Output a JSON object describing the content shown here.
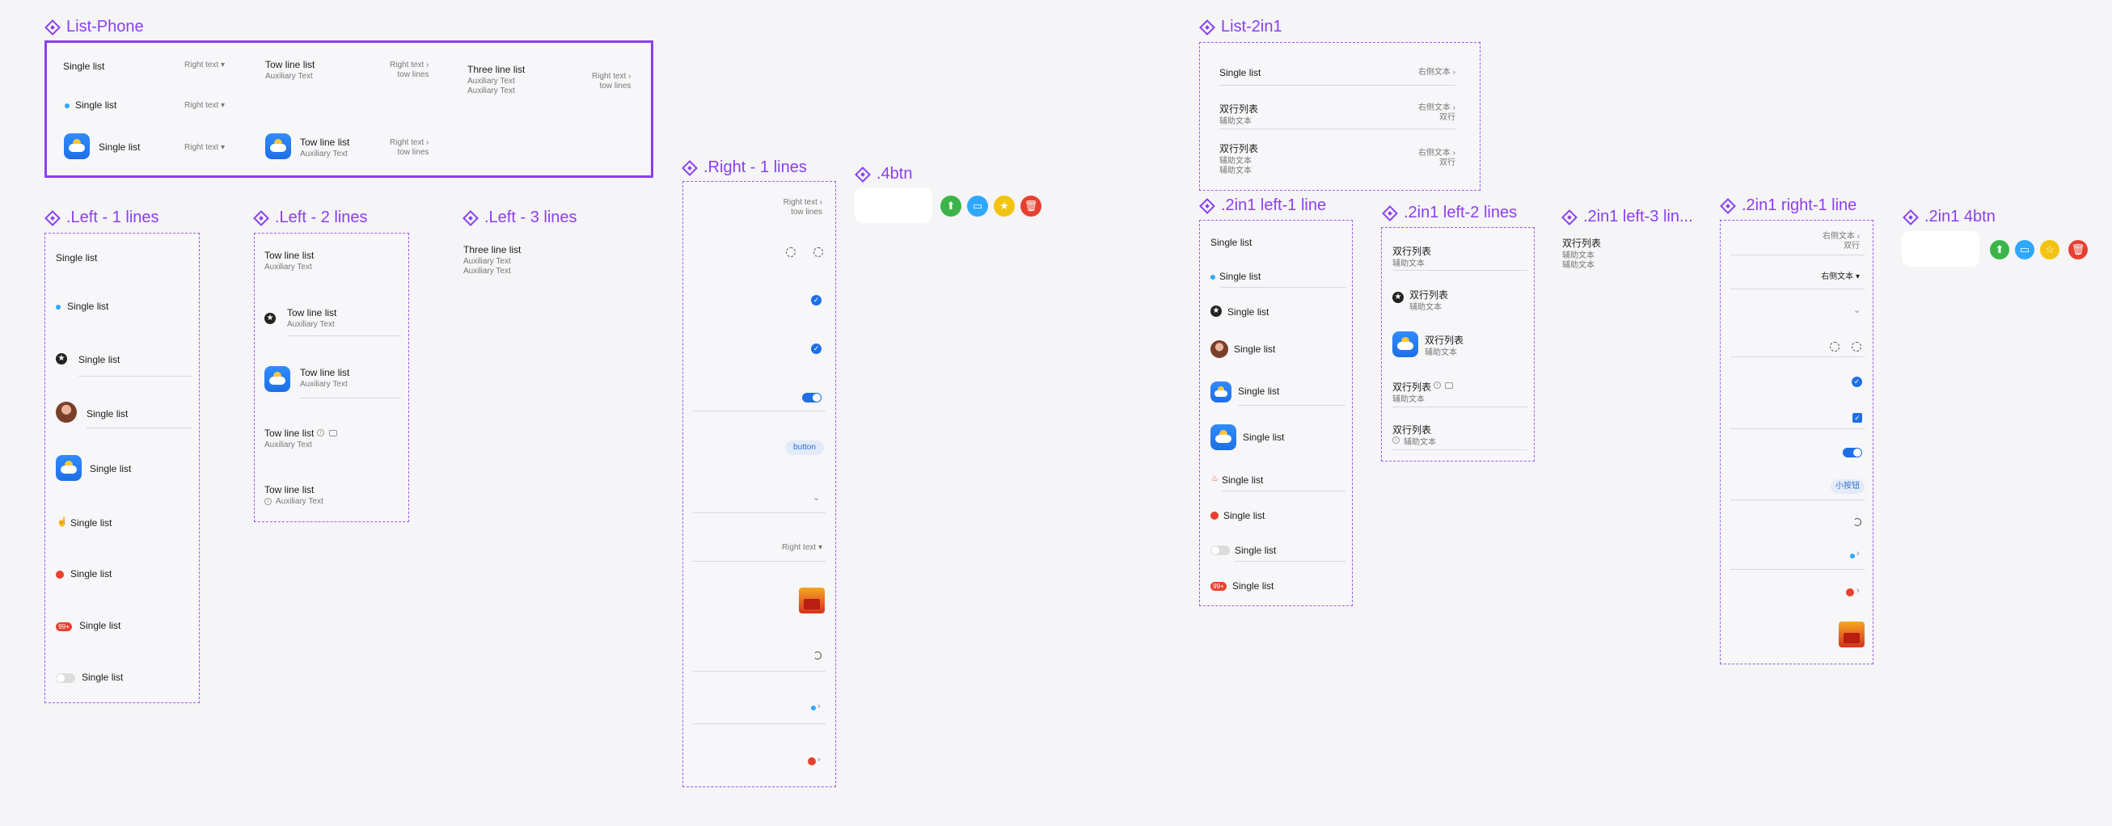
{
  "colors": {
    "accent": "#8a3ff0",
    "blue": "#1f6fe6",
    "green": "#3bb54a",
    "lightblue": "#2ea8ff",
    "yellow": "#f2c40f",
    "red": "#e8402f"
  },
  "frames": {
    "list_phone": "List-Phone",
    "left1": ".Left - 1 lines",
    "left2": ".Left - 2 lines",
    "left3": ".Left - 3 lines",
    "right1": ".Right - 1 lines",
    "fourbtn": ".4btn",
    "list_2in1": "List-2in1",
    "left1_2in1": ".2in1 left-1 line",
    "left2_2in1": ".2in1 left-2 lines",
    "left3_2in1": ".2in1 left-3 lin...",
    "right1_2in1": ".2in1 right-1 line",
    "fourbtn_2in1": ".2in1 4btn"
  },
  "phone": {
    "single": "Single list",
    "right_text": "Right text",
    "two_line": "Tow line list",
    "aux": "Auxiliary Text",
    "right_text_2": "Right text",
    "two_lines": "tow lines",
    "three_line": "Three line list"
  },
  "left1": {
    "label": "Single list",
    "badge": "99+"
  },
  "left2": {
    "title": "Tow line list",
    "aux": "Auxiliary Text"
  },
  "left3": {
    "title": "Three line list",
    "aux": "Auxiliary Text"
  },
  "right1": {
    "line1": "Right text",
    "line2": "tow lines",
    "button": "button",
    "right_text": "Right text"
  },
  "cn": {
    "single": "Single list",
    "right_text": "右侧文本",
    "double": "双行列表",
    "aux": "辅助文本",
    "two_rows": "双行",
    "dropdown": "右侧文本",
    "small_btn": "小按钮",
    "badge": "99+"
  }
}
